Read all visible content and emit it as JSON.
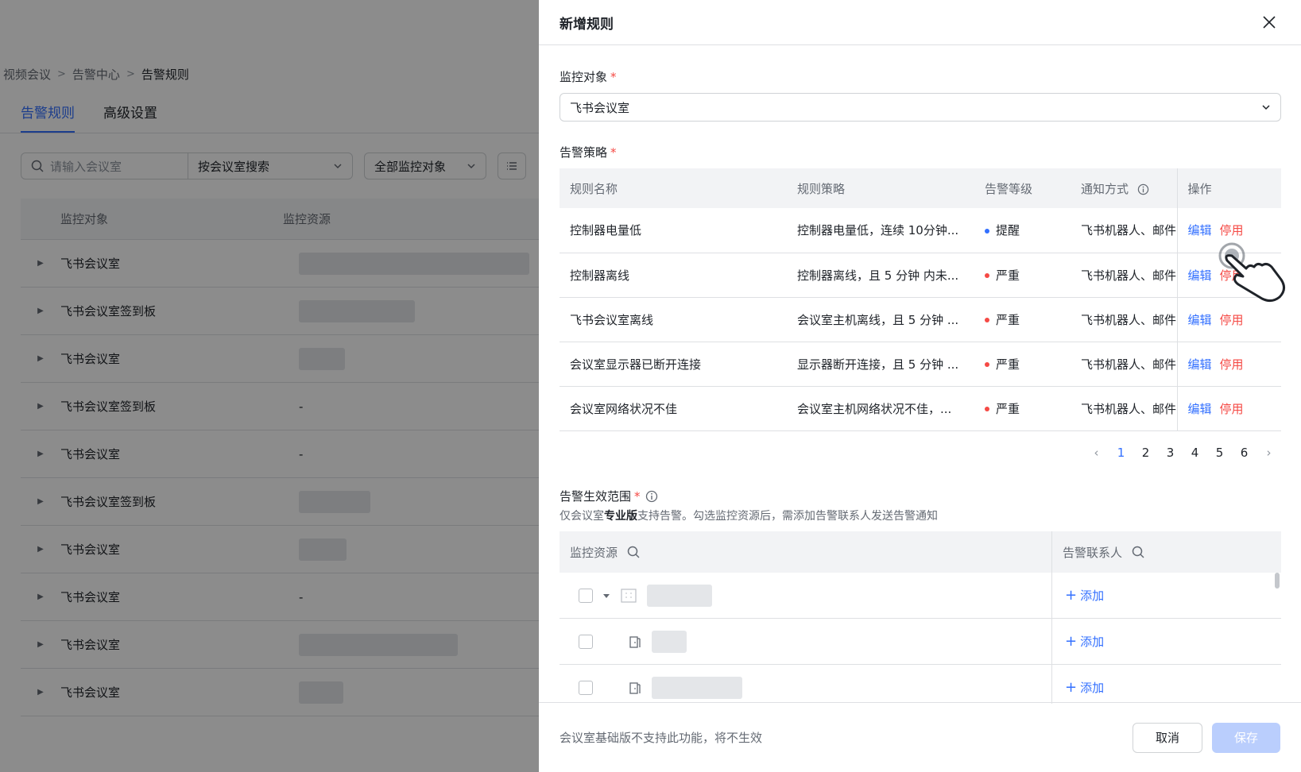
{
  "breadcrumb": [
    "视频会议",
    "告警中心",
    "告警规则"
  ],
  "tabs": [
    "告警规则",
    "高级设置"
  ],
  "filter": {
    "search_placeholder": "请输入会议室",
    "search_mode": "按会议室搜索",
    "monitor_object": "全部监控对象"
  },
  "bg_table": {
    "headers": [
      "监控对象",
      "监控资源"
    ],
    "rows": [
      {
        "name": "飞书会议室",
        "res": ""
      },
      {
        "name": "飞书会议室签到板",
        "res": ""
      },
      {
        "name": "飞书会议室",
        "res": ""
      },
      {
        "name": "飞书会议室签到板",
        "res": "-"
      },
      {
        "name": "飞书会议室",
        "res": "-"
      },
      {
        "name": "飞书会议室签到板",
        "res": ""
      },
      {
        "name": "飞书会议室",
        "res": ""
      },
      {
        "name": "飞书会议室",
        "res": "-"
      },
      {
        "name": "飞书会议室",
        "res": ""
      },
      {
        "name": "飞书会议室",
        "res": ""
      }
    ]
  },
  "drawer": {
    "title": "新增规则",
    "monitor_label": "监控对象",
    "monitor_value": "飞书会议室",
    "policy_label": "告警策略",
    "policy_headers": [
      "规则名称",
      "规则策略",
      "告警等级",
      "通知方式",
      "操作"
    ],
    "policy_rows": [
      {
        "name": "控制器电量低",
        "strategy": "控制器电量低，连续 10分钟...",
        "level": "提醒",
        "level_color": "#3370ff",
        "notify": "飞书机器人、邮件",
        "edit": "编辑",
        "stop": "停用"
      },
      {
        "name": "控制器离线",
        "strategy": "控制器离线，且 5 分钟 内未...",
        "level": "严重",
        "level_color": "#f54a45",
        "notify": "飞书机器人、邮件",
        "edit": "编辑",
        "stop": "停用"
      },
      {
        "name": "飞书会议室离线",
        "strategy": "会议室主机离线，且 5 分钟 ...",
        "level": "严重",
        "level_color": "#f54a45",
        "notify": "飞书机器人、邮件",
        "edit": "编辑",
        "stop": "停用"
      },
      {
        "name": "会议室显示器已断开连接",
        "strategy": "显示器断开连接，且 5 分钟 ...",
        "level": "严重",
        "level_color": "#f54a45",
        "notify": "飞书机器人、邮件",
        "edit": "编辑",
        "stop": "停用"
      },
      {
        "name": "会议室网络状况不佳",
        "strategy": "会议室主机网络状况不佳，...",
        "level": "严重",
        "level_color": "#f54a45",
        "notify": "飞书机器人、邮件",
        "edit": "编辑",
        "stop": "停用"
      }
    ],
    "pagination": [
      "1",
      "2",
      "3",
      "4",
      "5",
      "6"
    ],
    "scope_label": "告警生效范围",
    "scope_desc_prefix": "仅会议室",
    "scope_desc_bold": "专业版",
    "scope_desc_suffix": "支持告警。勾选监控资源后，需添加告警联系人发送告警通知",
    "scope_headers": [
      "监控资源",
      "告警联系人"
    ],
    "scope_add": "添加",
    "footer_note": "会议室基础版不支持此功能，将不生效",
    "cancel": "取消",
    "save": "保存"
  }
}
